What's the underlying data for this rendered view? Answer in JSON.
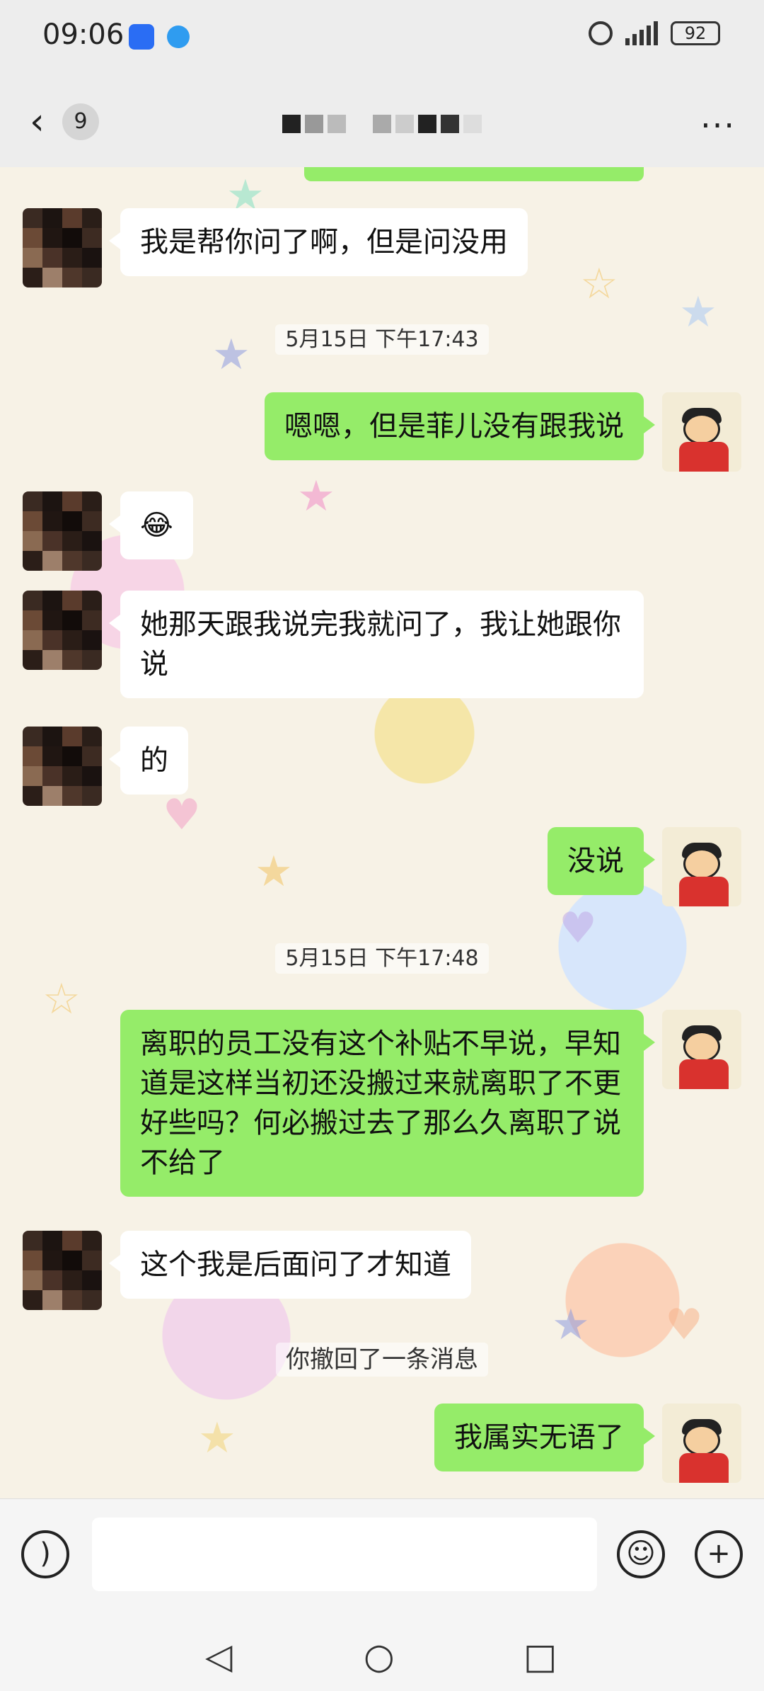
{
  "status_bar": {
    "time": "09:06",
    "battery": "92"
  },
  "header": {
    "unread_count": "9",
    "more_label": "···"
  },
  "messages": [
    {
      "side": "in",
      "text": "我是帮你问了啊，但是问没用"
    },
    {
      "type": "time",
      "text": "5月15日 下午17:43"
    },
    {
      "side": "out",
      "text": "嗯嗯，但是菲儿没有跟我说"
    },
    {
      "side": "in",
      "text": "😂"
    },
    {
      "side": "in",
      "text": "她那天跟我说完我就问了，我让她跟你说"
    },
    {
      "side": "in",
      "text": "的"
    },
    {
      "side": "out",
      "text": "没说"
    },
    {
      "type": "time",
      "text": "5月15日 下午17:48"
    },
    {
      "side": "out",
      "text": "离职的员工没有这个补贴不早说，早知道是这样当初还没搬过来就离职了不更好些吗？何必搬过去了那么久离职了说不给了"
    },
    {
      "side": "in",
      "text": "这个我是后面问了才知道"
    },
    {
      "type": "system",
      "text": "你撤回了一条消息"
    },
    {
      "side": "out",
      "text": "我属实无语了"
    }
  ],
  "input_bar": {
    "voice_icon": "voice-icon",
    "emoji_icon": "emoji-icon",
    "plus_icon": "plus-icon"
  },
  "nav": {
    "back_icon": "nav-back-icon",
    "home_icon": "nav-home-icon",
    "recent_icon": "nav-recent-icon"
  },
  "colors": {
    "out_bubble": "#95ec69",
    "in_bubble": "#ffffff",
    "header_bg": "#ededed"
  }
}
